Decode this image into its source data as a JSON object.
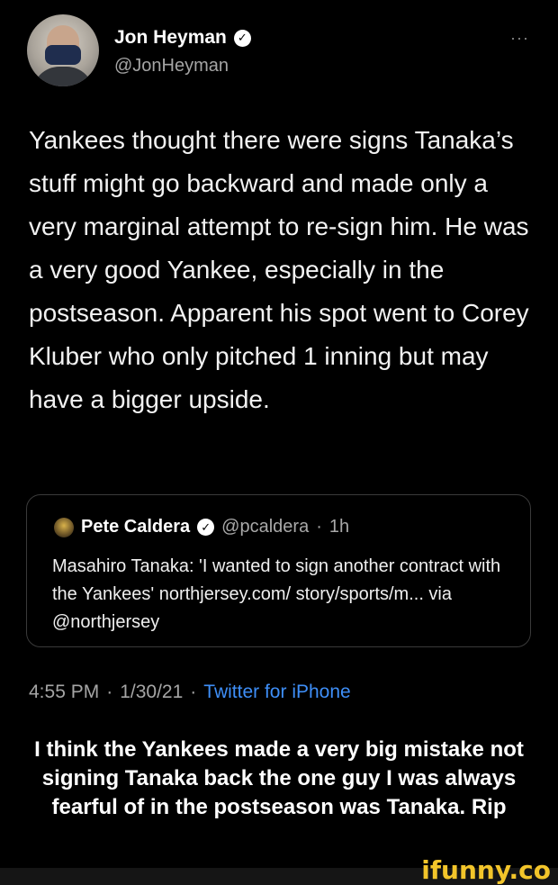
{
  "header": {
    "name": "Jon Heyman",
    "handle": "@JonHeyman",
    "more": "···"
  },
  "tweet": {
    "text": "Yankees thought there were signs Tanaka’s stuff might go backward and made only a very marginal attempt to re-sign him. He was a very good Yankee, especially in the postseason. Apparent his spot went to Corey Kluber who only pitched 1 inning but may have a bigger upside."
  },
  "quote": {
    "name": "Pete Caldera",
    "handle": "@pcaldera",
    "separator": "·",
    "time": "1h",
    "text": "Masahiro Tanaka: 'I wanted to sign another contract with the Yankees' northjersey.com/ story/sports/m... via @northjersey"
  },
  "meta": {
    "time": "4:55 PM",
    "sep1": "·",
    "date": "1/30/21",
    "sep2": "·",
    "source": "Twitter for iPhone"
  },
  "caption": "I think the Yankees made a very big mistake not signing Tanaka back the one guy I was always fearful of in the postseason was Tanaka. Rip",
  "watermark": "ifunny.co",
  "icons": {
    "verified": "verified-badge-icon",
    "more": "more-options-icon"
  },
  "colors": {
    "background": "#000000",
    "secondary_text": "#a5a5a5",
    "link": "#3e8ef7",
    "watermark": "#f3c52a"
  }
}
